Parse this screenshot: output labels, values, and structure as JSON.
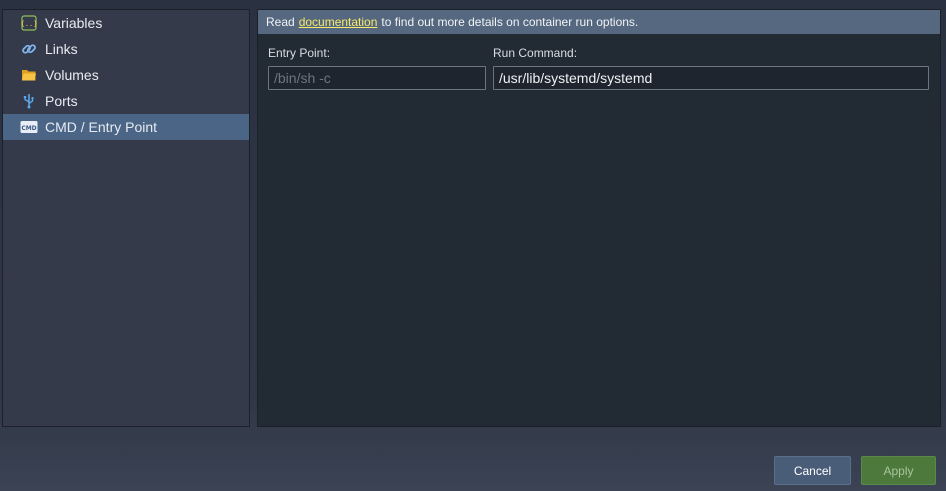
{
  "sidebar": {
    "items": [
      {
        "label": "Variables",
        "icon": "variables-icon"
      },
      {
        "label": "Links",
        "icon": "link-icon"
      },
      {
        "label": "Volumes",
        "icon": "folder-icon"
      },
      {
        "label": "Ports",
        "icon": "usb-port-icon"
      },
      {
        "label": "CMD / Entry Point",
        "icon": "cmd-icon",
        "active": true
      }
    ]
  },
  "info": {
    "prefix": "Read",
    "link": "documentation",
    "suffix": "to find out more details on container run options."
  },
  "fields": {
    "entry_point": {
      "label": "Entry Point:",
      "placeholder": "/bin/sh -c",
      "value": ""
    },
    "run_command": {
      "label": "Run Command:",
      "value": "/usr/lib/systemd/systemd"
    }
  },
  "buttons": {
    "cancel": "Cancel",
    "apply": "Apply"
  },
  "colors": {
    "active_item": "#4a6585",
    "info_bar": "#55687f",
    "link": "#f6e96b",
    "apply_button": "#4d7a3c",
    "cancel_button": "#4a5d78"
  }
}
